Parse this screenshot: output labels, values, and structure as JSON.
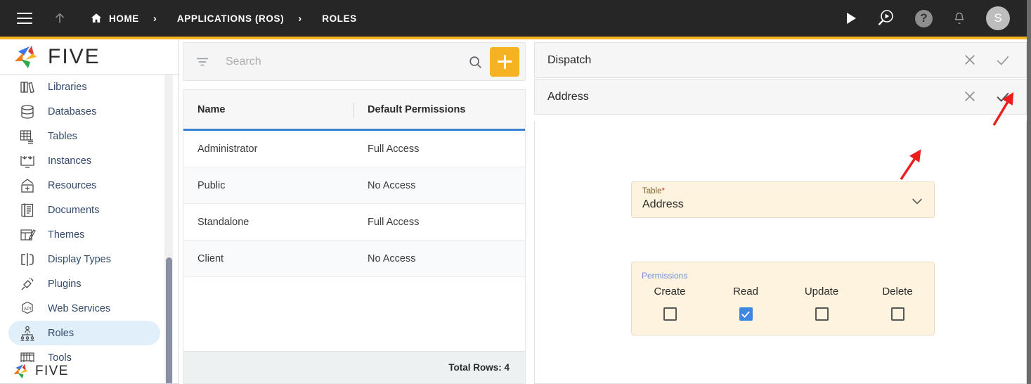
{
  "topbar": {
    "menu_icon": "hamburger-icon",
    "up_icon": "arrow-up-icon",
    "home_icon": "home-icon",
    "breadcrumbs": [
      {
        "label": "HOME"
      },
      {
        "label": "APPLICATIONS (ROS)"
      },
      {
        "label": "ROLES"
      }
    ],
    "separator": "›",
    "actions": [
      {
        "name": "run-icon"
      },
      {
        "name": "search-preview-icon"
      },
      {
        "name": "help-icon",
        "label": "?"
      },
      {
        "name": "notifications-bell-icon"
      }
    ],
    "avatar_initial": "S",
    "accent_color": "#f5b324",
    "background_color": "#262626"
  },
  "sidebar": {
    "logo_text": "FIVE",
    "items": [
      {
        "label": "Libraries",
        "icon": "libraries-icon",
        "active": false
      },
      {
        "label": "Databases",
        "icon": "databases-icon",
        "active": false
      },
      {
        "label": "Tables",
        "icon": "tables-icon",
        "active": false
      },
      {
        "label": "Instances",
        "icon": "instances-icon",
        "active": false
      },
      {
        "label": "Resources",
        "icon": "resources-icon",
        "active": false
      },
      {
        "label": "Documents",
        "icon": "documents-icon",
        "active": false
      },
      {
        "label": "Themes",
        "icon": "themes-icon",
        "active": false
      },
      {
        "label": "Display Types",
        "icon": "display-types-icon",
        "active": false
      },
      {
        "label": "Plugins",
        "icon": "plugins-icon",
        "active": false
      },
      {
        "label": "Web Services",
        "icon": "web-services-icon",
        "active": false
      },
      {
        "label": "Roles",
        "icon": "roles-icon",
        "active": true
      },
      {
        "label": "Tools",
        "icon": "tools-icon",
        "active": false
      }
    ],
    "active_item": "Roles",
    "active_color": "#e1effb"
  },
  "list_panel": {
    "search": {
      "placeholder": "Search",
      "value": "",
      "filter_icon": "filter-icon",
      "search_icon": "search-icon"
    },
    "add_button": {
      "icon": "plus-icon",
      "color": "#f5b324"
    },
    "table": {
      "columns": [
        "Name",
        "Default Permissions"
      ],
      "rows": [
        {
          "name": "Administrator",
          "permissions": "Full Access"
        },
        {
          "name": "Public",
          "permissions": "No Access"
        },
        {
          "name": "Standalone",
          "permissions": "Full Access"
        },
        {
          "name": "Client",
          "permissions": "No Access"
        }
      ],
      "footer": "Total Rows: 4",
      "header_accent": "#3c82d0"
    }
  },
  "right_panel": {
    "cards": [
      {
        "title": "Dispatch",
        "close_icon": "close-icon",
        "confirm_icon": "check-icon",
        "confirm_active": false
      },
      {
        "title": "Address",
        "close_icon": "close-icon",
        "confirm_icon": "check-icon",
        "confirm_active": true
      }
    ],
    "form": {
      "table_field": {
        "label": "Table",
        "required_marker": "*",
        "value": "Address",
        "chevron_icon": "chevron-down-icon"
      },
      "permissions": {
        "title": "Permissions",
        "options": [
          {
            "label": "Create",
            "checked": false
          },
          {
            "label": "Read",
            "checked": true
          },
          {
            "label": "Update",
            "checked": false
          },
          {
            "label": "Delete",
            "checked": false
          }
        ],
        "checked_color": "#3c87e0",
        "background_color": "#fdf3de"
      }
    }
  },
  "annotations": [
    {
      "name": "arrow-to-confirm-check",
      "color": "#ee1c1c"
    },
    {
      "name": "arrow-to-table-chevron",
      "color": "#ee1c1c"
    }
  ]
}
